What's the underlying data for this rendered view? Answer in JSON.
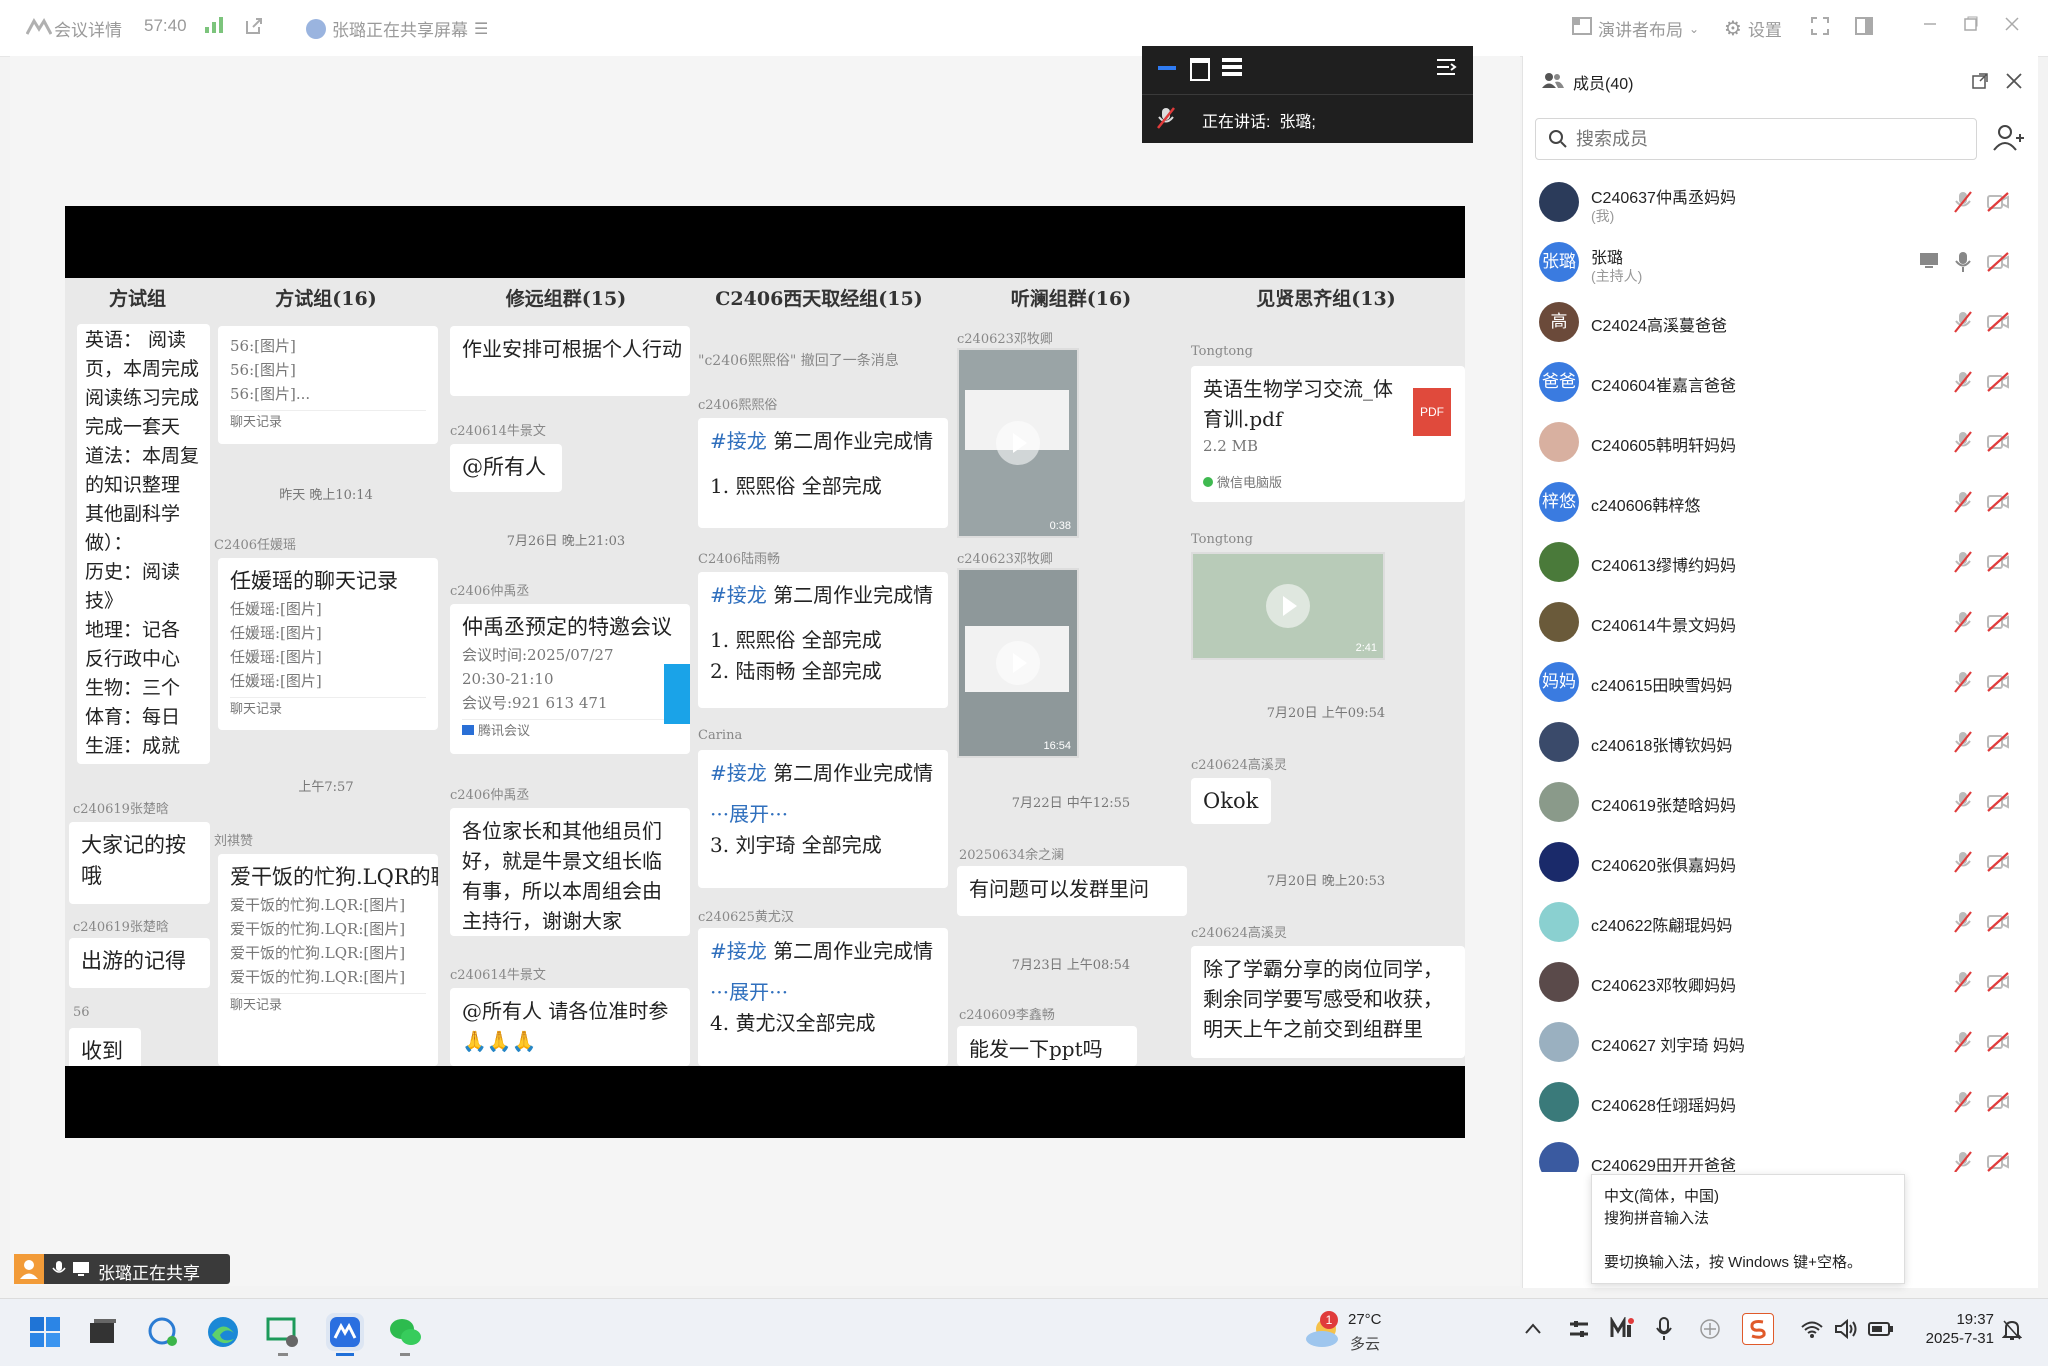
{
  "topbar": {
    "meeting_details": "会议详情",
    "timer": "57:40",
    "sharing_status": "张璐正在共享屏幕",
    "layout_label": "演讲者布局",
    "settings_label": "设置"
  },
  "float_panel": {
    "speaking_label": "正在讲话:",
    "speaker": "张璐;"
  },
  "shared_screen": {
    "columns": [
      {
        "header": "方试组"
      },
      {
        "header": "方试组(16)"
      },
      {
        "header": "修远组群(15)"
      },
      {
        "header": "C2406西天取经组(15)"
      },
      {
        "header": "听澜组群(16)"
      },
      {
        "header": "见贤思齐组(13)"
      }
    ],
    "col1": {
      "lines": [
        "英语：  阅读",
        "页，本周完成",
        "阅读练习完成",
        "完成一套天",
        "道法：本周复",
        "的知识整理",
        "其他副科学",
        "做）：",
        "历史：阅读",
        "技》",
        "地理：记各",
        "反行政中心",
        "生物：三个",
        "体育：每日",
        "生涯：成就"
      ],
      "m1": "c240619张楚晗",
      "b1": "大家记的按",
      "b1b": "哦",
      "m2": "c240619张楚晗",
      "b2": "出游的记得",
      "m3": "56",
      "b3": "收到"
    },
    "col2": {
      "b1": [
        "56:[图片]",
        "56:[图片]",
        "56:[图片]..."
      ],
      "b1_footer": "聊天记录",
      "t1": "昨天 晚上10:14",
      "m1": "C2406任媛瑶",
      "b2_title": "任媛瑶的聊天记录",
      "b2": [
        "任媛瑶:[图片]",
        "任媛瑶:[图片]",
        "任媛瑶:[图片]",
        "任媛瑶:[图片]"
      ],
      "b2_footer": "聊天记录",
      "t2": "上午7:57",
      "m2": "刘祺赞",
      "b3_title": "爱干饭的忙狗.LQR的聊天记录",
      "b3": [
        "爱干饭的忙狗.LQR:[图片]",
        "爱干饭的忙狗.LQR:[图片]",
        "爱干饭的忙狗.LQR:[图片]",
        "爱干饭的忙狗.LQR:[图片]"
      ],
      "b3_footer": "聊天记录"
    },
    "col3": {
      "b1": "作业安排可根据个人行动",
      "m1": "c240614牛景文",
      "b2": "@所有人",
      "t1": "7月26日 晚上21:03",
      "m2": "c2406仲禹丞",
      "b3_title": "仲禹丞预定的特邀会议",
      "b3": [
        "会议时间:2025/07/27",
        "20:30-21:10",
        "会议号:921 613 471"
      ],
      "b3_footer": "腾讯会议",
      "m3": "c2406仲禹丞",
      "b4": "各位家长和其他组员们好，就是牛景文组长临有事，所以本周组会由主持行，谢谢大家",
      "m4": "c240614牛景文",
      "b5": "@所有人 请各位准时参",
      "b5_emoji": "🙏🙏🙏"
    },
    "col4": {
      "recall": "\"c2406熙熙俗\" 撤回了一条消息",
      "m1": "c2406熙熙俗",
      "b1_tag": "#接龙",
      "b1_title": "第二周作业完成情",
      "b1": [
        "1. 熙熙俗 全部完成"
      ],
      "m2": "C2406陆雨畅",
      "b2_tag": "#接龙",
      "b2_title": "第二周作业完成情",
      "b2": [
        "1. 熙熙俗 全部完成",
        "2. 陆雨畅 全部完成"
      ],
      "m3": "Carina",
      "b3_tag": "#接龙",
      "b3_title": "第二周作业完成情",
      "b3_more": "···展开···",
      "b3": [
        "3. 刘宇琦 全部完成"
      ],
      "m4": "c240625黄尤汉",
      "b4_tag": "#接龙",
      "b4_title": "第二周作业完成情",
      "b4_more": "···展开···",
      "b4": [
        "4. 黄尤汉全部完成"
      ]
    },
    "col5": {
      "m1": "c240623邓牧卿",
      "v1_dur": "0:38",
      "m2": "c240623邓牧卿",
      "v2_dur": "16:54",
      "t1": "7月22日 中午12:55",
      "m3": "20250634余之澜",
      "b1": "有问题可以发群里问",
      "t2": "7月23日 上午08:54",
      "m4": "c240609李鑫畅",
      "b2": "能发一下ppt吗"
    },
    "col6": {
      "m1": "Tongtong",
      "file_title": "英语生物学习交流_体育训.pdf",
      "file_size": "2.2 MB",
      "file_badge": "PDF",
      "file_source": "微信电脑版",
      "m2": "Tongtong",
      "v_dur": "2:41",
      "t1": "7月20日 上午09:54",
      "m3": "c240624高溪灵",
      "b1": "Okok",
      "t2": "7月20日 晚上20:53",
      "m4": "c240624高溪灵",
      "b2": "除了学霸分享的岗位同学，剩余同学要写感受和收获，明天上午之前交到组群里"
    }
  },
  "members_panel": {
    "title": "成员(40)",
    "search_placeholder": "搜索成员",
    "members": [
      {
        "name": "C240637仲禹丞妈妈",
        "role": "(我)",
        "avatar_text": "",
        "color": "#2b3b5a"
      },
      {
        "name": "张璐",
        "role": "(主持人)",
        "avatar_text": "张璐",
        "color": "#3a7be0"
      },
      {
        "name": "C24024高溪蔓爸爸",
        "role": "",
        "avatar_text": "高",
        "color": "#6b4a3a"
      },
      {
        "name": "C240604崔嘉言爸爸",
        "role": "",
        "avatar_text": "爸爸",
        "color": "#3a7be0"
      },
      {
        "name": "C240605韩明轩妈妈",
        "role": "",
        "avatar_text": "",
        "color": "#d8b0a0"
      },
      {
        "name": "c240606韩梓悠",
        "role": "",
        "avatar_text": "梓悠",
        "color": "#3a7be0"
      },
      {
        "name": "C240613缪博约妈妈",
        "role": "",
        "avatar_text": "",
        "color": "#4a7a3a"
      },
      {
        "name": "C240614牛景文妈妈",
        "role": "",
        "avatar_text": "",
        "color": "#6a5a3a"
      },
      {
        "name": "c240615田映雪妈妈",
        "role": "",
        "avatar_text": "妈妈",
        "color": "#3a7be0"
      },
      {
        "name": "c240618张博钦妈妈",
        "role": "",
        "avatar_text": "",
        "color": "#3a4a6a"
      },
      {
        "name": "C240619张楚晗妈妈",
        "role": "",
        "avatar_text": "",
        "color": "#8a9a8a"
      },
      {
        "name": "C240620张俱嘉妈妈",
        "role": "",
        "avatar_text": "",
        "color": "#1a2a6a"
      },
      {
        "name": "c240622陈翩琨妈妈",
        "role": "",
        "avatar_text": "",
        "color": "#8ad0d0"
      },
      {
        "name": "C240623邓牧卿妈妈",
        "role": "",
        "avatar_text": "",
        "color": "#5a4a4a"
      },
      {
        "name": "C240627 刘宇琦 妈妈",
        "role": "",
        "avatar_text": "",
        "color": "#9ab0c0"
      },
      {
        "name": "C240628任翊瑶妈妈",
        "role": "",
        "avatar_text": "",
        "color": "#3a7a7a"
      },
      {
        "name": "C240629田开开爸爸",
        "role": "",
        "avatar_text": "",
        "color": "#3a5aa0"
      }
    ]
  },
  "ime_tooltip": {
    "line1": "中文(简体，中国)",
    "line2": "搜狗拼音输入法",
    "line3": "要切换输入法，按 Windows 键+空格。"
  },
  "share_label": "张璐正在共享",
  "taskbar": {
    "weather_temp": "27°C",
    "weather_desc": "多云",
    "weather_badge": "1",
    "time": "19:37",
    "date": "2025-7-31"
  }
}
